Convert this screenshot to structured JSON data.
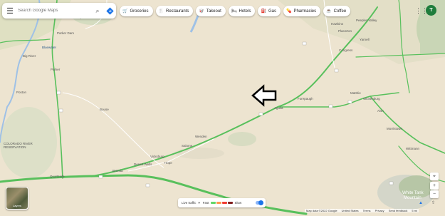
{
  "search": {
    "placeholder": "Search Google Maps"
  },
  "chips": [
    {
      "icon": "shopping-cart-icon",
      "glyph": "🛒",
      "label": "Groceries"
    },
    {
      "icon": "restaurant-icon",
      "glyph": "🍴",
      "label": "Restaurants"
    },
    {
      "icon": "takeout-icon",
      "glyph": "🥡",
      "label": "Takeout"
    },
    {
      "icon": "hotel-icon",
      "glyph": "🛏",
      "label": "Hotels"
    },
    {
      "icon": "gas-icon",
      "glyph": "⛽",
      "label": "Gas"
    },
    {
      "icon": "pharmacy-icon",
      "glyph": "💊",
      "label": "Pharmacies"
    },
    {
      "icon": "coffee-icon",
      "glyph": "☕",
      "label": "Coffee"
    }
  ],
  "account": {
    "initial": "T",
    "color": "#1e7d3c"
  },
  "layers": {
    "label": "Layers"
  },
  "traffic": {
    "label": "Live traffic",
    "fast": "Fast",
    "slow": "Slow",
    "colors": [
      "#63d668",
      "#ff974d",
      "#f23c32",
      "#811f1f"
    ]
  },
  "map": {
    "places": [
      "Parker Strip",
      "Parker Dam",
      "Bluewater",
      "Big River",
      "Parker",
      "Poston",
      "COLORADO RIVER RESERVATION",
      "Bouse",
      "Quartzsite",
      "Brenda",
      "Desert Wells",
      "Vicksburg",
      "Hope",
      "Salome",
      "Wenden",
      "Aguila",
      "Forepaugh",
      "Congress",
      "Hawkins",
      "Peeples Valley",
      "Yarnell",
      "Placerton",
      "Wickenburg",
      "Matthie",
      "Aish",
      "Morristown",
      "Wittmann",
      "White Tank Mountain"
    ],
    "mountain_label": "White Tank\nMountain"
  },
  "footer": [
    "Map data ©2022 Google",
    "United States",
    "Terms",
    "Privacy",
    "Send feedback",
    "5 mi"
  ],
  "controls": {
    "zoom_in": "+",
    "zoom_out": "−"
  }
}
